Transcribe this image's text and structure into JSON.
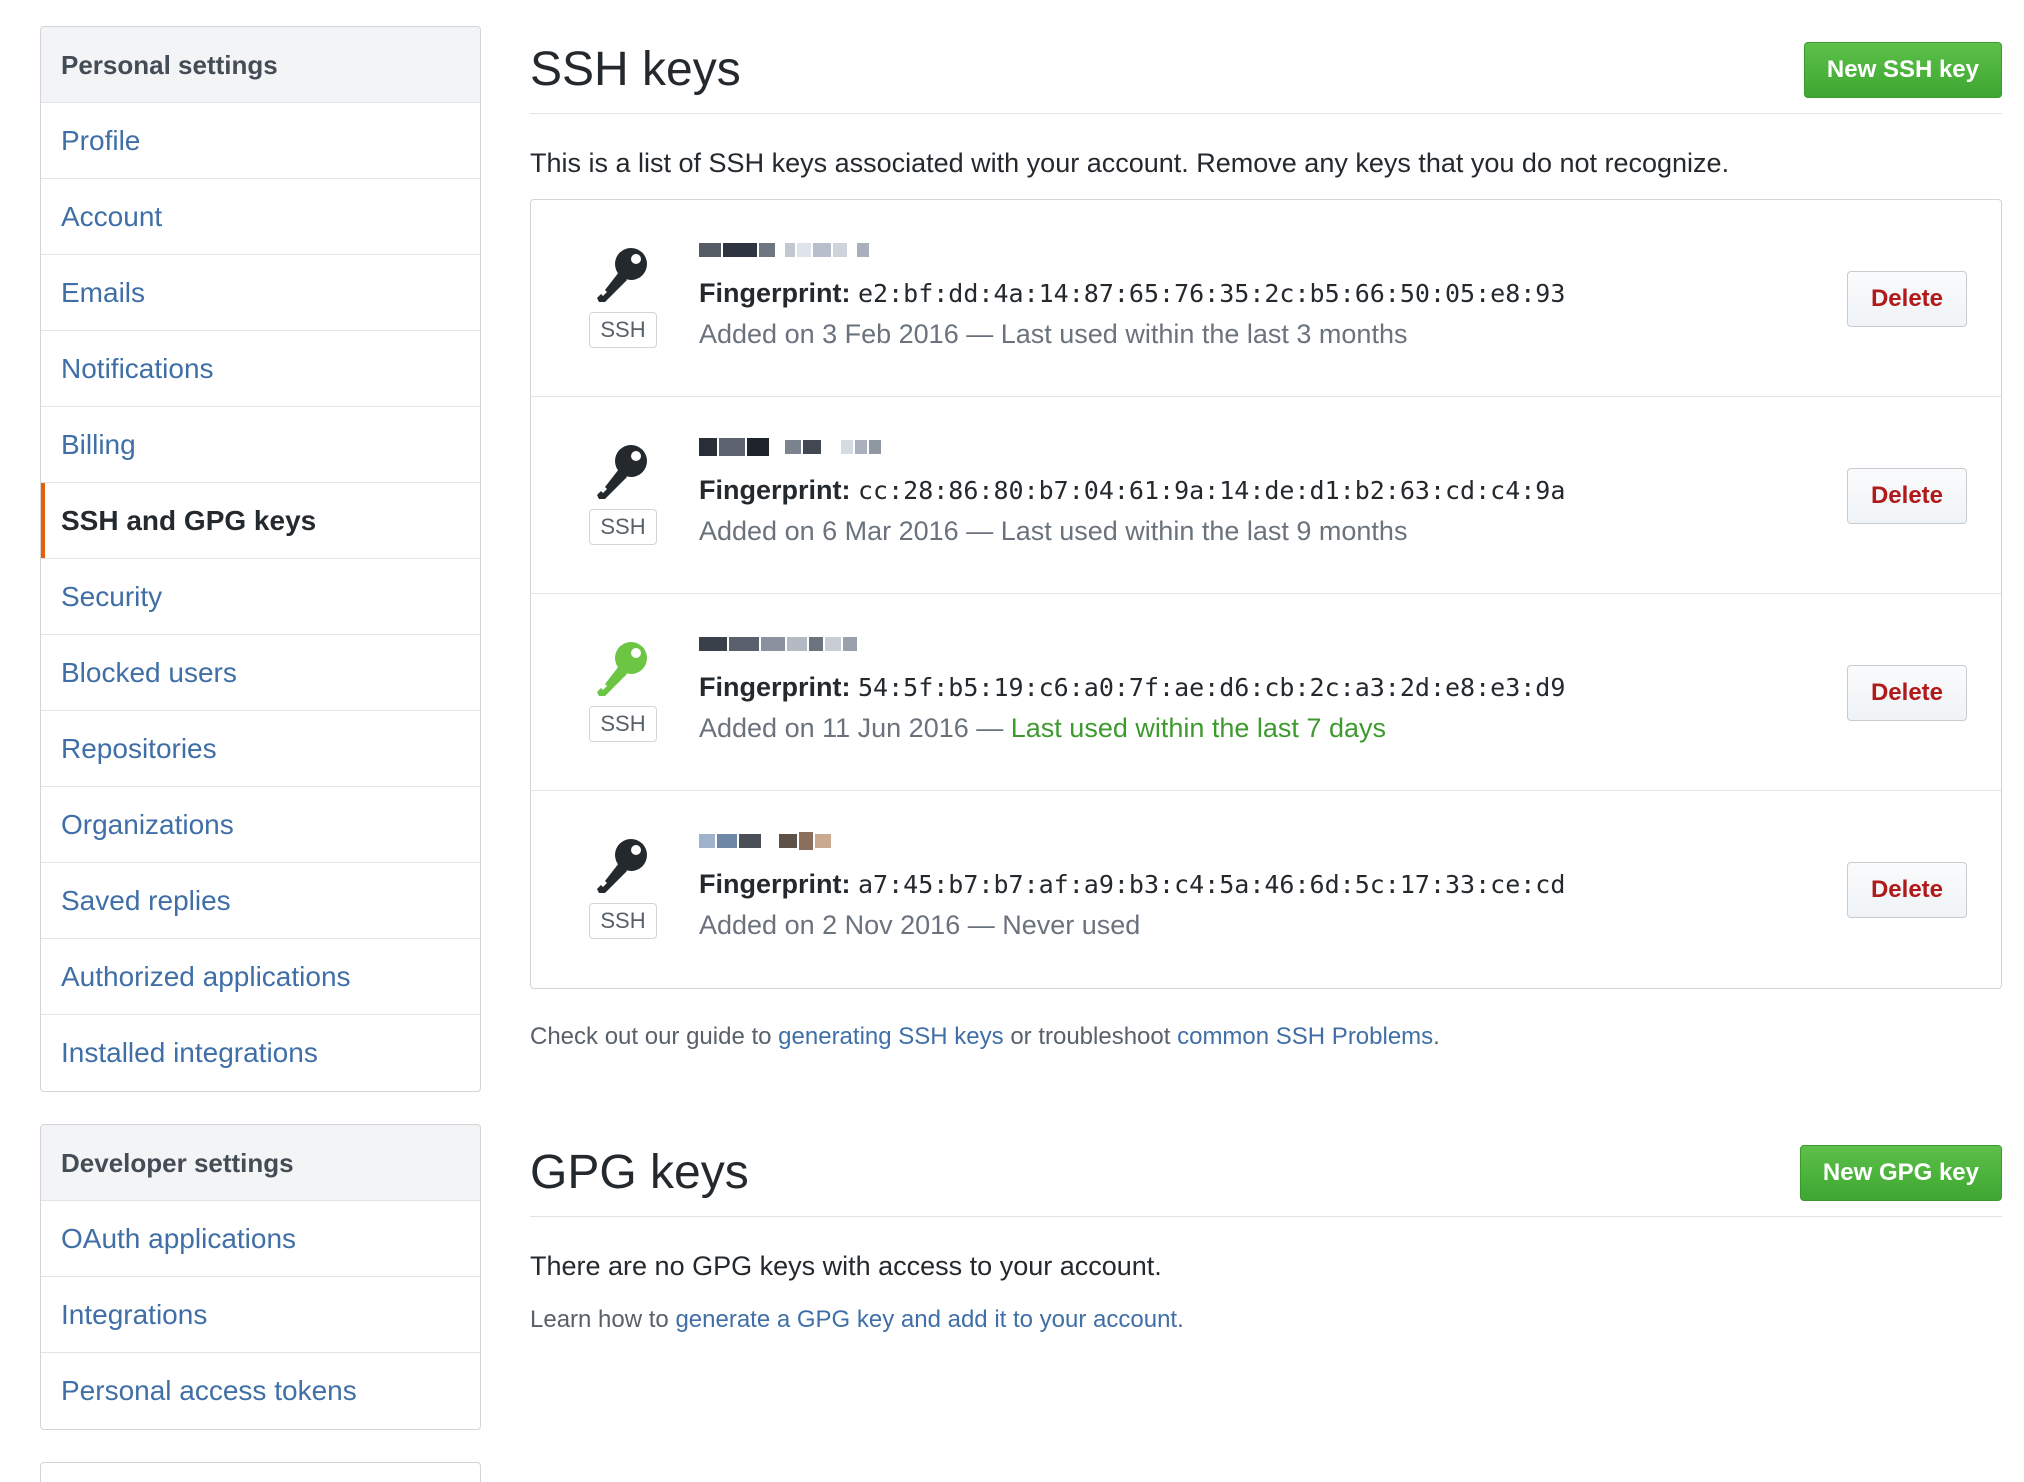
{
  "sidebar": {
    "personal": {
      "heading": "Personal settings",
      "items": [
        {
          "label": "Profile"
        },
        {
          "label": "Account"
        },
        {
          "label": "Emails"
        },
        {
          "label": "Notifications"
        },
        {
          "label": "Billing"
        },
        {
          "label": "SSH and GPG keys",
          "selected": true
        },
        {
          "label": "Security"
        },
        {
          "label": "Blocked users"
        },
        {
          "label": "Repositories"
        },
        {
          "label": "Organizations"
        },
        {
          "label": "Saved replies"
        },
        {
          "label": "Authorized applications"
        },
        {
          "label": "Installed integrations"
        }
      ]
    },
    "developer": {
      "heading": "Developer settings",
      "items": [
        {
          "label": "OAuth applications"
        },
        {
          "label": "Integrations"
        },
        {
          "label": "Personal access tokens"
        }
      ]
    }
  },
  "ssh": {
    "title": "SSH keys",
    "new_button": "New SSH key",
    "intro": "This is a list of SSH keys associated with your account. Remove any keys that you do not recognize.",
    "fingerprint_label": "Fingerprint:",
    "type_label": "SSH",
    "delete_label": "Delete",
    "keys": [
      {
        "fingerprint": "e2:bf:dd:4a:14:87:65:76:35:2c:b5:66:50:05:e8:93",
        "added": "Added on 3 Feb 2016 —",
        "last_used": "Last used within the last 3 months",
        "recent": false,
        "icon_color": "#24292e"
      },
      {
        "fingerprint": "cc:28:86:80:b7:04:61:9a:14:de:d1:b2:63:cd:c4:9a",
        "added": "Added on 6 Mar 2016 —",
        "last_used": "Last used within the last 9 months",
        "recent": false,
        "icon_color": "#24292e"
      },
      {
        "fingerprint": "54:5f:b5:19:c6:a0:7f:ae:d6:cb:2c:a3:2d:e8:e3:d9",
        "added": "Added on 11 Jun 2016 —",
        "last_used": "Last used within the last 7 days",
        "recent": true,
        "icon_color": "#6cc644"
      },
      {
        "fingerprint": "a7:45:b7:b7:af:a9:b3:c4:5a:46:6d:5c:17:33:ce:cd",
        "added": "Added on 2 Nov 2016 —",
        "last_used": "Never used",
        "recent": false,
        "icon_color": "#24292e"
      }
    ],
    "help": {
      "prefix": "Check out our guide to",
      "link1": "generating SSH keys",
      "middle": "or troubleshoot",
      "link2": "common SSH Problems",
      "suffix": "."
    }
  },
  "gpg": {
    "title": "GPG keys",
    "new_button": "New GPG key",
    "empty": "There are no GPG keys with access to your account.",
    "learn_prefix": "Learn how to",
    "learn_link": "generate a GPG key and add it to your account",
    "learn_suffix": "."
  },
  "colors": {
    "link": "#3f6fa6",
    "selected_accent": "#e36209",
    "primary_button": "#3ea731",
    "danger_text": "#b11a1a",
    "recent_text": "#3e9a2f"
  }
}
